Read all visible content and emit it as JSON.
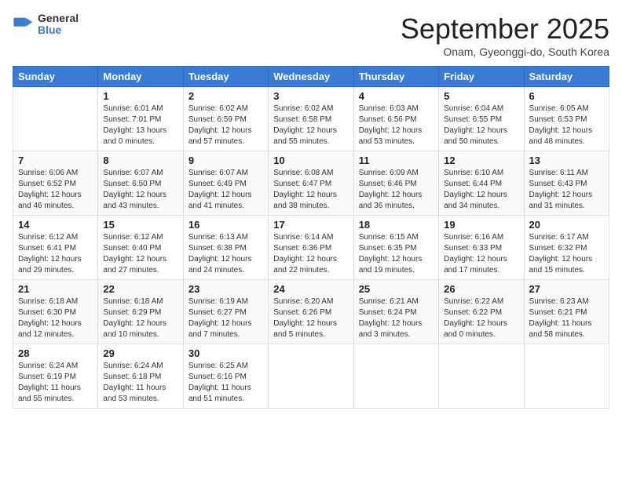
{
  "header": {
    "logo_general": "General",
    "logo_blue": "Blue",
    "month": "September 2025",
    "location": "Onam, Gyeonggi-do, South Korea"
  },
  "weekdays": [
    "Sunday",
    "Monday",
    "Tuesday",
    "Wednesday",
    "Thursday",
    "Friday",
    "Saturday"
  ],
  "weeks": [
    [
      {
        "day": "",
        "info": ""
      },
      {
        "day": "1",
        "info": "Sunrise: 6:01 AM\nSunset: 7:01 PM\nDaylight: 13 hours\nand 0 minutes."
      },
      {
        "day": "2",
        "info": "Sunrise: 6:02 AM\nSunset: 6:59 PM\nDaylight: 12 hours\nand 57 minutes."
      },
      {
        "day": "3",
        "info": "Sunrise: 6:02 AM\nSunset: 6:58 PM\nDaylight: 12 hours\nand 55 minutes."
      },
      {
        "day": "4",
        "info": "Sunrise: 6:03 AM\nSunset: 6:56 PM\nDaylight: 12 hours\nand 53 minutes."
      },
      {
        "day": "5",
        "info": "Sunrise: 6:04 AM\nSunset: 6:55 PM\nDaylight: 12 hours\nand 50 minutes."
      },
      {
        "day": "6",
        "info": "Sunrise: 6:05 AM\nSunset: 6:53 PM\nDaylight: 12 hours\nand 48 minutes."
      }
    ],
    [
      {
        "day": "7",
        "info": "Sunrise: 6:06 AM\nSunset: 6:52 PM\nDaylight: 12 hours\nand 46 minutes."
      },
      {
        "day": "8",
        "info": "Sunrise: 6:07 AM\nSunset: 6:50 PM\nDaylight: 12 hours\nand 43 minutes."
      },
      {
        "day": "9",
        "info": "Sunrise: 6:07 AM\nSunset: 6:49 PM\nDaylight: 12 hours\nand 41 minutes."
      },
      {
        "day": "10",
        "info": "Sunrise: 6:08 AM\nSunset: 6:47 PM\nDaylight: 12 hours\nand 38 minutes."
      },
      {
        "day": "11",
        "info": "Sunrise: 6:09 AM\nSunset: 6:46 PM\nDaylight: 12 hours\nand 36 minutes."
      },
      {
        "day": "12",
        "info": "Sunrise: 6:10 AM\nSunset: 6:44 PM\nDaylight: 12 hours\nand 34 minutes."
      },
      {
        "day": "13",
        "info": "Sunrise: 6:11 AM\nSunset: 6:43 PM\nDaylight: 12 hours\nand 31 minutes."
      }
    ],
    [
      {
        "day": "14",
        "info": "Sunrise: 6:12 AM\nSunset: 6:41 PM\nDaylight: 12 hours\nand 29 minutes."
      },
      {
        "day": "15",
        "info": "Sunrise: 6:12 AM\nSunset: 6:40 PM\nDaylight: 12 hours\nand 27 minutes."
      },
      {
        "day": "16",
        "info": "Sunrise: 6:13 AM\nSunset: 6:38 PM\nDaylight: 12 hours\nand 24 minutes."
      },
      {
        "day": "17",
        "info": "Sunrise: 6:14 AM\nSunset: 6:36 PM\nDaylight: 12 hours\nand 22 minutes."
      },
      {
        "day": "18",
        "info": "Sunrise: 6:15 AM\nSunset: 6:35 PM\nDaylight: 12 hours\nand 19 minutes."
      },
      {
        "day": "19",
        "info": "Sunrise: 6:16 AM\nSunset: 6:33 PM\nDaylight: 12 hours\nand 17 minutes."
      },
      {
        "day": "20",
        "info": "Sunrise: 6:17 AM\nSunset: 6:32 PM\nDaylight: 12 hours\nand 15 minutes."
      }
    ],
    [
      {
        "day": "21",
        "info": "Sunrise: 6:18 AM\nSunset: 6:30 PM\nDaylight: 12 hours\nand 12 minutes."
      },
      {
        "day": "22",
        "info": "Sunrise: 6:18 AM\nSunset: 6:29 PM\nDaylight: 12 hours\nand 10 minutes."
      },
      {
        "day": "23",
        "info": "Sunrise: 6:19 AM\nSunset: 6:27 PM\nDaylight: 12 hours\nand 7 minutes."
      },
      {
        "day": "24",
        "info": "Sunrise: 6:20 AM\nSunset: 6:26 PM\nDaylight: 12 hours\nand 5 minutes."
      },
      {
        "day": "25",
        "info": "Sunrise: 6:21 AM\nSunset: 6:24 PM\nDaylight: 12 hours\nand 3 minutes."
      },
      {
        "day": "26",
        "info": "Sunrise: 6:22 AM\nSunset: 6:22 PM\nDaylight: 12 hours\nand 0 minutes."
      },
      {
        "day": "27",
        "info": "Sunrise: 6:23 AM\nSunset: 6:21 PM\nDaylight: 11 hours\nand 58 minutes."
      }
    ],
    [
      {
        "day": "28",
        "info": "Sunrise: 6:24 AM\nSunset: 6:19 PM\nDaylight: 11 hours\nand 55 minutes."
      },
      {
        "day": "29",
        "info": "Sunrise: 6:24 AM\nSunset: 6:18 PM\nDaylight: 11 hours\nand 53 minutes."
      },
      {
        "day": "30",
        "info": "Sunrise: 6:25 AM\nSunset: 6:16 PM\nDaylight: 11 hours\nand 51 minutes."
      },
      {
        "day": "",
        "info": ""
      },
      {
        "day": "",
        "info": ""
      },
      {
        "day": "",
        "info": ""
      },
      {
        "day": "",
        "info": ""
      }
    ]
  ]
}
